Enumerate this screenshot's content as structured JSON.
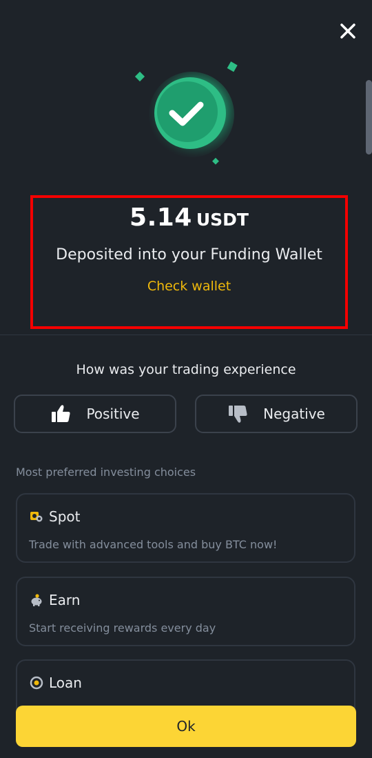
{
  "result": {
    "amount": "5.14",
    "currency": "USDT",
    "message": "Deposited into your Funding Wallet",
    "link": "Check wallet"
  },
  "feedback": {
    "question": "How was your trading experience",
    "positive_label": "Positive",
    "negative_label": "Negative"
  },
  "choices": {
    "title": "Most preferred investing choices",
    "items": [
      {
        "title": "Spot",
        "desc": "Trade with advanced tools and buy BTC now!",
        "icon": "spot-icon"
      },
      {
        "title": "Earn",
        "desc": "Start receiving rewards every day",
        "icon": "piggy-bank-icon"
      },
      {
        "title": "Loan",
        "desc": "",
        "icon": "loan-icon"
      }
    ]
  },
  "footer": {
    "ok_label": "Ok"
  },
  "colors": {
    "background": "#1e2329",
    "accent_yellow": "#fcd535",
    "link_gold": "#f0b90b",
    "success_green": "#2ebd85",
    "highlight_red": "#f40000"
  }
}
